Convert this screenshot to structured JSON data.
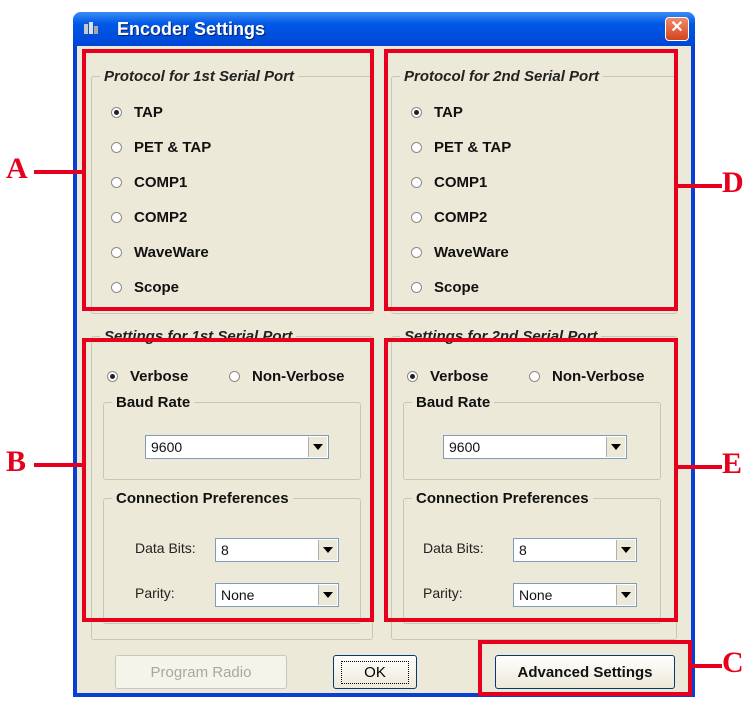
{
  "window": {
    "title": "Encoder Settings",
    "close_glyph": "✕"
  },
  "protocol1": {
    "legend": "Protocol for 1st Serial Port",
    "options": [
      "TAP",
      "PET & TAP",
      "COMP1",
      "COMP2",
      "WaveWare",
      "Scope"
    ],
    "selected": "TAP"
  },
  "protocol2": {
    "legend": "Protocol for 2nd Serial Port",
    "options": [
      "TAP",
      "PET & TAP",
      "COMP1",
      "COMP2",
      "WaveWare",
      "Scope"
    ],
    "selected": "TAP"
  },
  "settings1": {
    "legend": "Settings for 1st Serial Port",
    "verbose_label": "Verbose",
    "nonverbose_label": "Non-Verbose",
    "verbose_selected": true,
    "baud_legend": "Baud Rate",
    "baud_value": "9600",
    "conn_legend": "Connection Preferences",
    "data_bits_label": "Data Bits:",
    "data_bits_value": "8",
    "parity_label": "Parity:",
    "parity_value": "None"
  },
  "settings2": {
    "legend": "Settings for 2nd Serial Port",
    "verbose_label": "Verbose",
    "nonverbose_label": "Non-Verbose",
    "verbose_selected": true,
    "baud_legend": "Baud Rate",
    "baud_value": "9600",
    "conn_legend": "Connection Preferences",
    "data_bits_label": "Data Bits:",
    "data_bits_value": "8",
    "parity_label": "Parity:",
    "parity_value": "None"
  },
  "buttons": {
    "program_radio": "Program Radio",
    "ok": "OK",
    "advanced": "Advanced Settings"
  },
  "callouts": {
    "a": "A",
    "b": "B",
    "c": "C",
    "d": "D",
    "e": "E"
  },
  "colors": {
    "highlight": "#e6001e",
    "titlebar": "#0058e6",
    "dialog_bg": "#ece9d8"
  }
}
